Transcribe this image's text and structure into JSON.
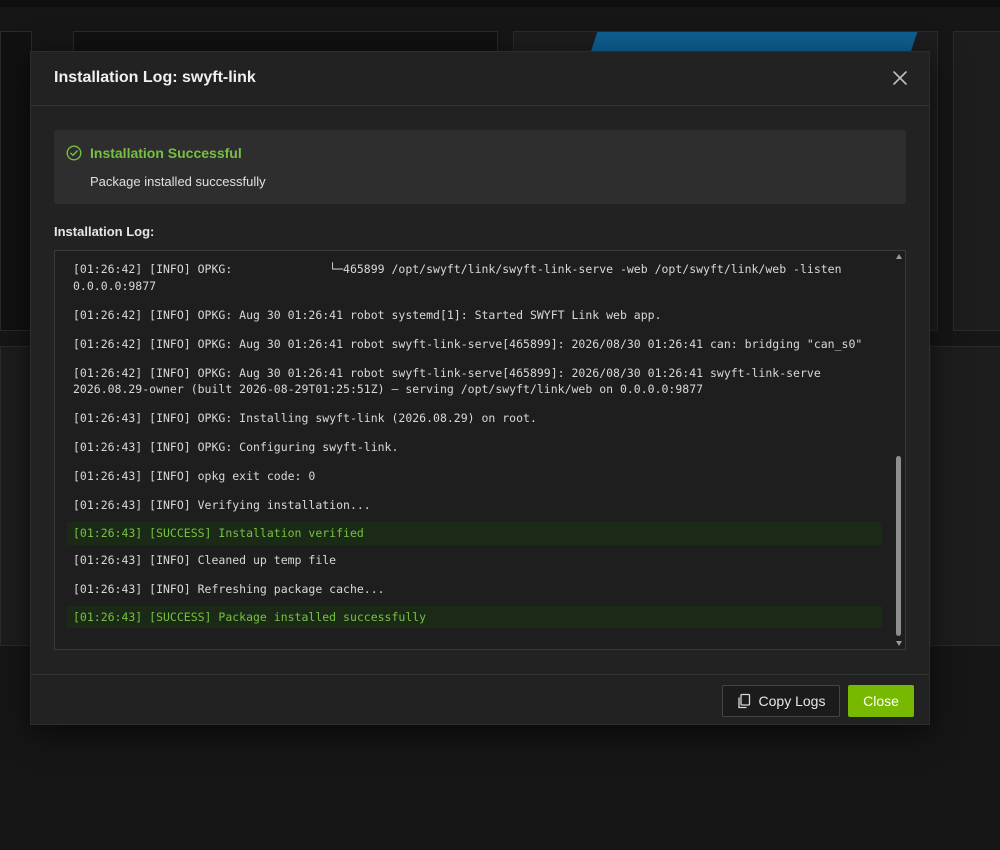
{
  "modal": {
    "title": "Installation Log: swyft-link",
    "close_icon": "close-icon"
  },
  "status": {
    "title": "Installation Successful",
    "message": "Package installed successfully",
    "icon": "check-circle-icon",
    "color": "#76c043"
  },
  "log": {
    "label": "Installation Log:",
    "lines": [
      {
        "text": "[01:26:42] [INFO] OPKG:              └─465899 /opt/swyft/link/swyft-link-serve -web /opt/swyft/link/web -listen 0.0.0.0:9877",
        "type": "info"
      },
      {
        "text": "[01:26:42] [INFO] OPKG: Aug 30 01:26:41 robot systemd[1]: Started SWYFT Link web app.",
        "type": "info"
      },
      {
        "text": "[01:26:42] [INFO] OPKG: Aug 30 01:26:41 robot swyft-link-serve[465899]: 2026/08/30 01:26:41 can: bridging \"can_s0\"",
        "type": "info"
      },
      {
        "text": "[01:26:42] [INFO] OPKG: Aug 30 01:26:41 robot swyft-link-serve[465899]: 2026/08/30 01:26:41 swyft-link-serve 2026.08.29-owner (built 2026-08-29T01:25:51Z) — serving /opt/swyft/link/web on 0.0.0.0:9877",
        "type": "info"
      },
      {
        "text": "[01:26:43] [INFO] OPKG: Installing swyft-link (2026.08.29) on root.",
        "type": "info"
      },
      {
        "text": "[01:26:43] [INFO] OPKG: Configuring swyft-link.",
        "type": "info"
      },
      {
        "text": "[01:26:43] [INFO] opkg exit code: 0",
        "type": "info"
      },
      {
        "text": "[01:26:43] [INFO] Verifying installation...",
        "type": "info"
      },
      {
        "text": "[01:26:43] [SUCCESS] Installation verified",
        "type": "success"
      },
      {
        "text": "[01:26:43] [INFO] Cleaned up temp file",
        "type": "info"
      },
      {
        "text": "[01:26:43] [INFO] Refreshing package cache...",
        "type": "info"
      },
      {
        "text": "[01:26:43] [SUCCESS] Package installed successfully",
        "type": "success"
      }
    ]
  },
  "footer": {
    "copy_label": "Copy Logs",
    "copy_icon": "copy-icon",
    "close_label": "Close",
    "close_color": "#76b900"
  }
}
